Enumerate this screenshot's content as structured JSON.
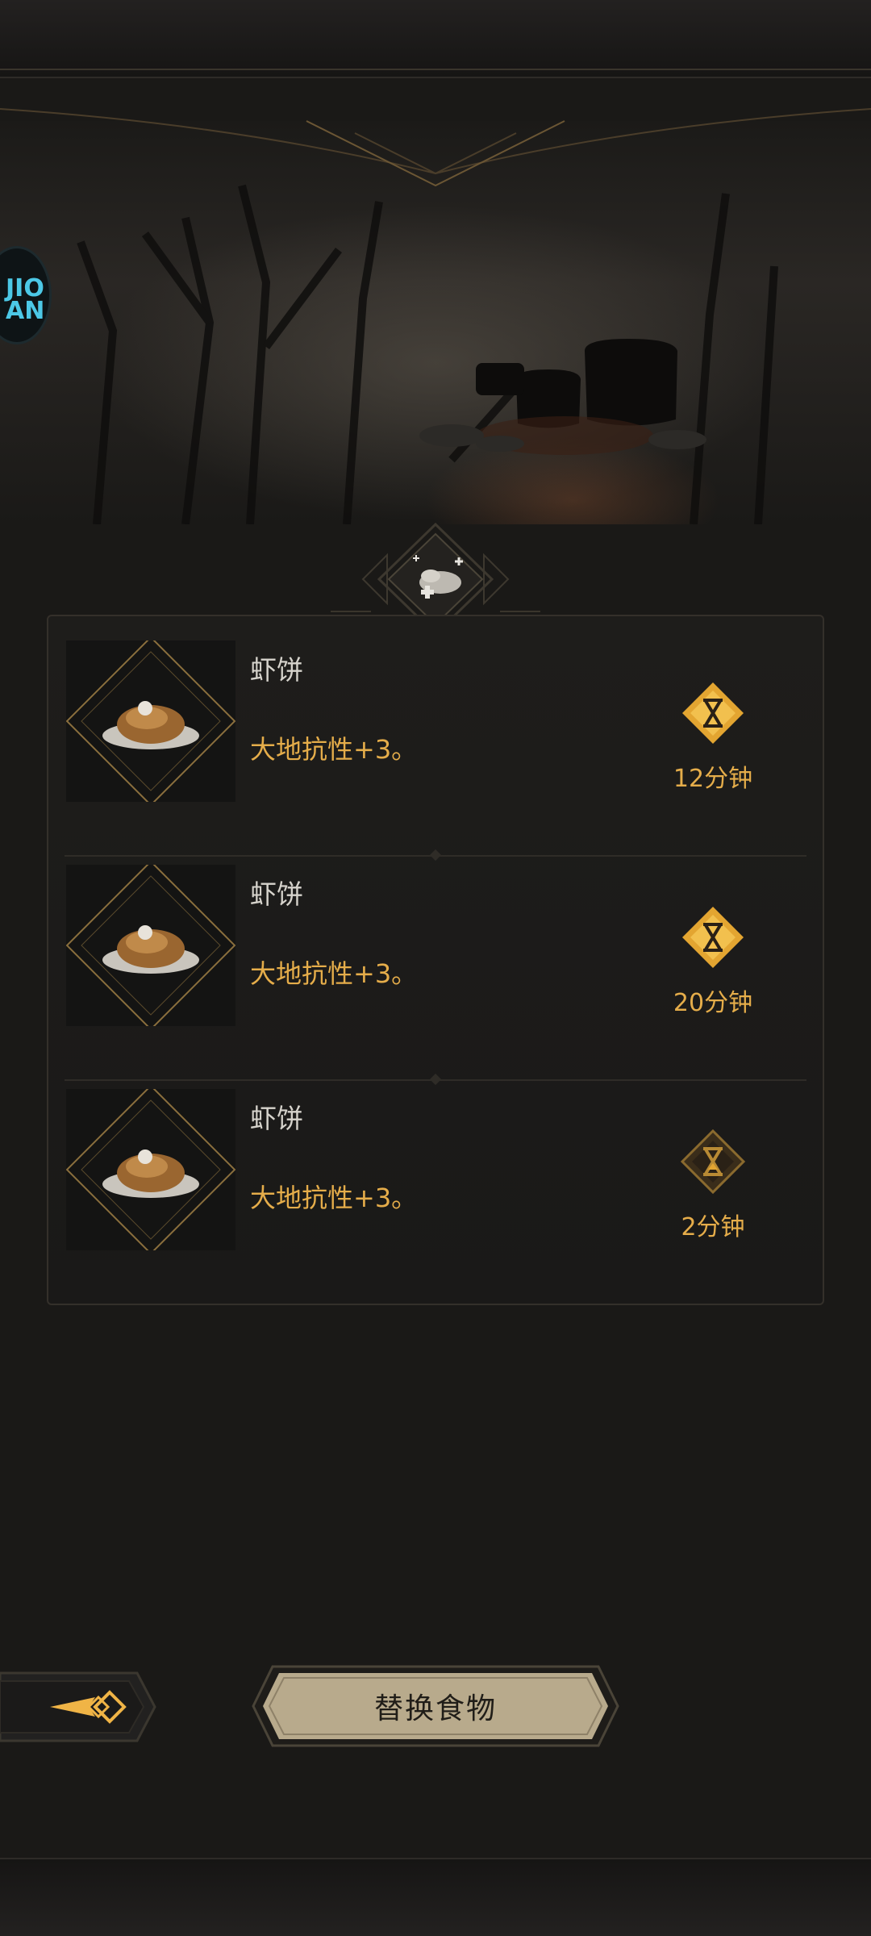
{
  "header": {
    "badge_icon": "food-buff-icon"
  },
  "overlay": {
    "bubble_text": "JIO\nAN",
    "bubble_icon": "assistive-bubble-icon"
  },
  "food_list": [
    {
      "name": "虾饼",
      "effect": "大地抗性+3。",
      "timer": "12分钟",
      "timer_icon": "hourglass-icon",
      "timer_active": true
    },
    {
      "name": "虾饼",
      "effect": "大地抗性+3。",
      "timer": "20分钟",
      "timer_icon": "hourglass-icon",
      "timer_active": true
    },
    {
      "name": "虾饼",
      "effect": "大地抗性+3。",
      "timer": "2分钟",
      "timer_icon": "hourglass-icon",
      "timer_active": false
    }
  ],
  "footer": {
    "back_icon": "back-arrow-icon",
    "replace_label": "替换食物"
  },
  "colors": {
    "accent_gold": "#e5ad4a",
    "text_light": "#d6d3cc",
    "background": "#1a1917"
  }
}
